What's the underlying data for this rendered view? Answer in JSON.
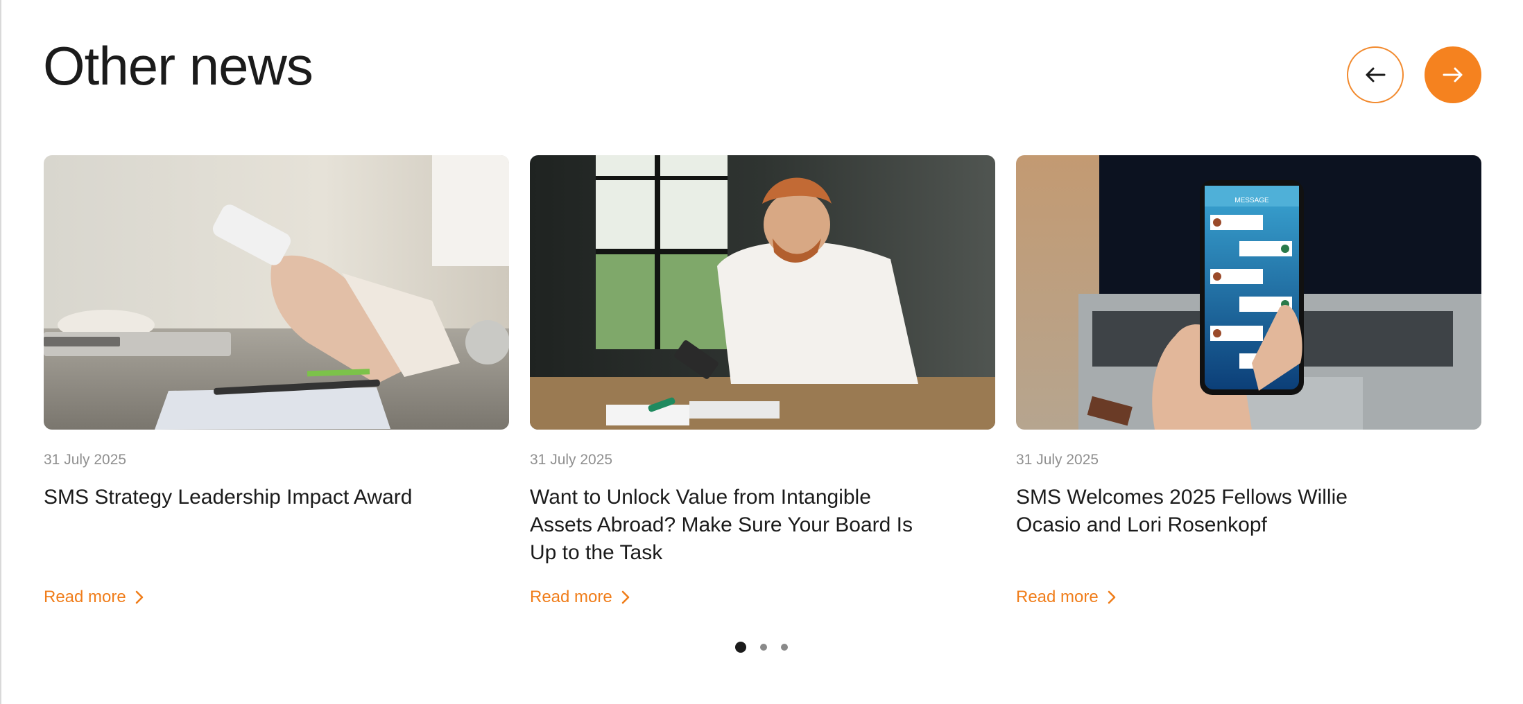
{
  "section": {
    "title": "Other news"
  },
  "carousel": {
    "prev_icon": "arrow-left-icon",
    "next_icon": "arrow-right-icon",
    "accent_color": "#f5821f",
    "dots": {
      "count": 3,
      "active_index": 0
    }
  },
  "cards": [
    {
      "date": "31 July 2025",
      "title": "SMS Strategy Leadership Impact Award",
      "read_more": "Read more",
      "image": "hands-holding-smartphone-photo"
    },
    {
      "date": "31 July 2025",
      "title": "Want to Unlock Value from Intangible Assets Abroad? Make Sure Your Board Is Up to the Task",
      "read_more": "Read more",
      "image": "man-smiling-at-phone-photo"
    },
    {
      "date": "31 July 2025",
      "title": "SMS Welcomes 2025 Fellows Willie Ocasio and Lori Rosenkopf",
      "read_more": "Read more",
      "image": "phone-message-app-photo"
    }
  ],
  "phone_screen": {
    "header": "MESSAGE"
  }
}
